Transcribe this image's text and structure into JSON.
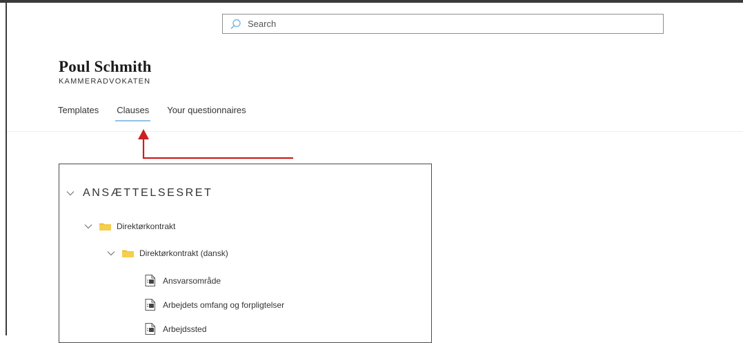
{
  "search": {
    "placeholder": "Search"
  },
  "brand": {
    "name": "Poul Schmith",
    "subtitle": "KAMMERADVOKATEN"
  },
  "nav": {
    "tabs": [
      {
        "label": "Templates",
        "active": false
      },
      {
        "label": "Clauses",
        "active": true
      },
      {
        "label": "Your questionnaires",
        "active": false
      }
    ]
  },
  "tree": {
    "section": "ANSÆTTELSESRET",
    "folder": "Direktørkontrakt",
    "subfolder": "Direktørkontrakt (dansk)",
    "documents": [
      "Ansvarsområde",
      "Arbejdets omfang og forpligtelser",
      "Arbejdssted"
    ]
  },
  "colors": {
    "annotation_arrow": "#cc1f1f",
    "active_tab_underline": "#8fc3e6",
    "folder": "#f2c232"
  },
  "icons": {
    "search": "search-icon",
    "expand": "chevron-down-icon",
    "folder": "folder-icon",
    "document": "document-icon"
  }
}
